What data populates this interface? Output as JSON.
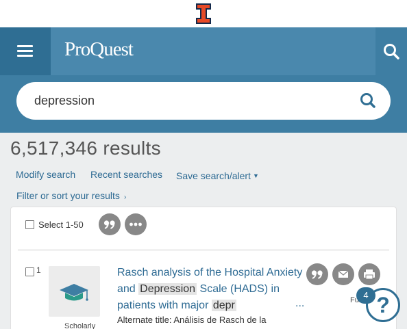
{
  "brand": {
    "logo_text": "ProQuest",
    "university_mark": "university-block-i-logo"
  },
  "header": {
    "menu_icon": "hamburger-menu-icon",
    "search_toggle_icon": "search-icon"
  },
  "search": {
    "query": "depression",
    "submit_icon": "search-icon"
  },
  "results": {
    "count_label": "6,517,346 results",
    "links": {
      "modify_search": "Modify search",
      "recent_searches": "Recent searches",
      "save_search": "Save search/alert",
      "filter_sort": "Filter or sort your results"
    }
  },
  "toolbar": {
    "select_label": "Select 1-50",
    "cite_icon": "quote-icon",
    "more_icon": "more-options-icon"
  },
  "result_items": [
    {
      "number": "1",
      "doc_type": "Scholarly",
      "thumb_icon": "scholarly-journal-icon",
      "title_part1": "Rasch analysis of the Hospital Anxiety and ",
      "title_highlight1": "Depression",
      "title_part2": " Scale (HADS) in patients with major ",
      "title_highlight2": "depr",
      "ellipsis": "...",
      "alt_title": "Alternate title: Análisis de Rasch de la",
      "full_text_label": "Full",
      "actions": [
        "quote-icon",
        "email-icon",
        "print-icon"
      ]
    }
  ],
  "help": {
    "badge_count": "4",
    "icon": "?"
  },
  "colors": {
    "header": "#3e7ea3",
    "link": "#2d6a93",
    "illinois_orange": "#e84a27",
    "illinois_navy": "#13294b"
  }
}
